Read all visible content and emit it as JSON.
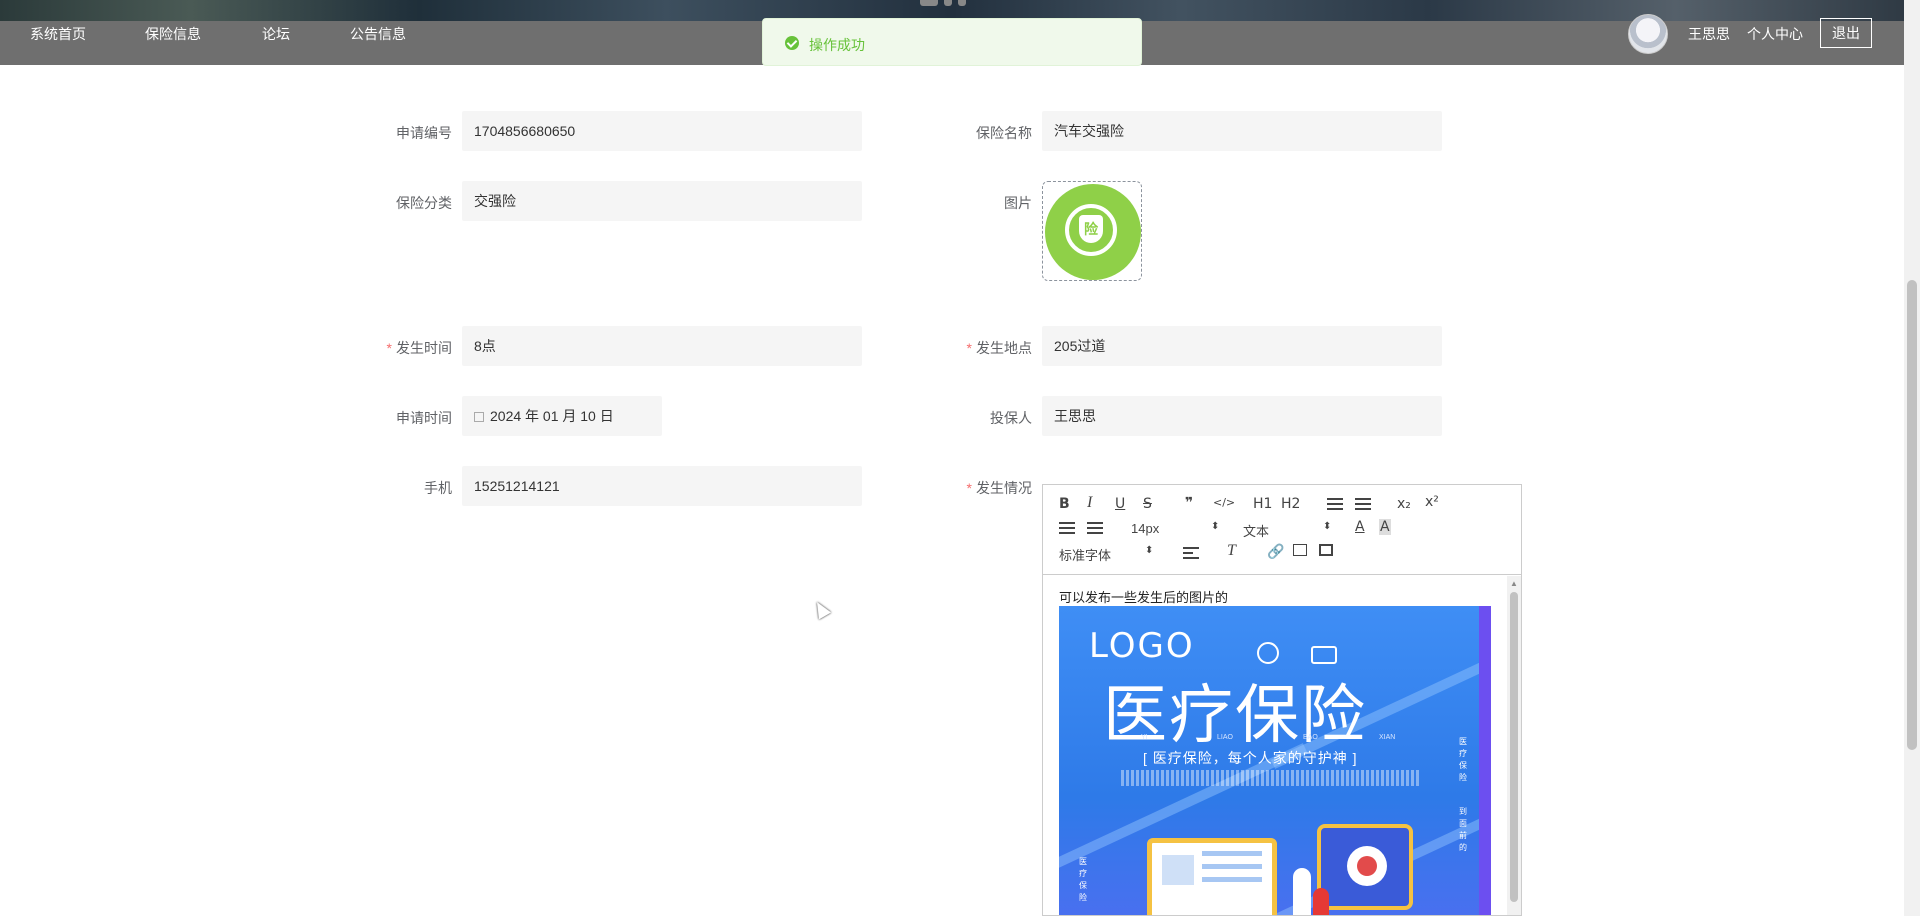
{
  "nav": {
    "links": [
      "系统首页",
      "保险信息",
      "论坛",
      "公告信息"
    ],
    "user_name": "王思思",
    "center_label": "个人中心",
    "logout_label": "退出"
  },
  "toast": {
    "message": "操作成功",
    "type": "success"
  },
  "form": {
    "application_no": {
      "label": "申请编号",
      "value": "1704856680650"
    },
    "insurance_name": {
      "label": "保险名称",
      "value": "汽车交强险"
    },
    "insurance_category": {
      "label": "保险分类",
      "value": "交强险"
    },
    "image": {
      "label": "图片",
      "badge_char": "险"
    },
    "occur_time": {
      "label": "发生时间",
      "value": "8点",
      "required": true
    },
    "occur_place": {
      "label": "发生地点",
      "value": "205过道",
      "required": true
    },
    "apply_time": {
      "label": "申请时间",
      "value": "2024 年 01 月 10 日"
    },
    "insured": {
      "label": "投保人",
      "value": "王思思"
    },
    "phone": {
      "label": "手机",
      "value": "15251214121"
    },
    "situation": {
      "label": "发生情况",
      "required": true
    }
  },
  "editor": {
    "toolbar": {
      "bold": "B",
      "italic": "I",
      "underline": "U",
      "strike": "S",
      "quote": "❞",
      "code": "</>",
      "h1": "H1",
      "h2": "H2",
      "sub": "x₂",
      "sup": "x²",
      "size_value": "14px",
      "header_value": "文本",
      "font_value": "标准字体"
    },
    "content_text": "可以发布一些发生后的图片的",
    "poster": {
      "logo": "LOGO",
      "title": "医疗保险",
      "pinyin": [
        "YI",
        "LIAO",
        "BAO",
        "XIAN"
      ],
      "slogan": "[ 医疗保险，每个人家的守护神 ]",
      "side_text": "医疗保险",
      "side_text2": "到面前的",
      "side_text3": "医疗保险"
    }
  },
  "colors": {
    "nav_bg": "#6f6f6f",
    "success": "#67c23a",
    "required": "#f56c6c",
    "field_bg": "#f5f5f5"
  }
}
